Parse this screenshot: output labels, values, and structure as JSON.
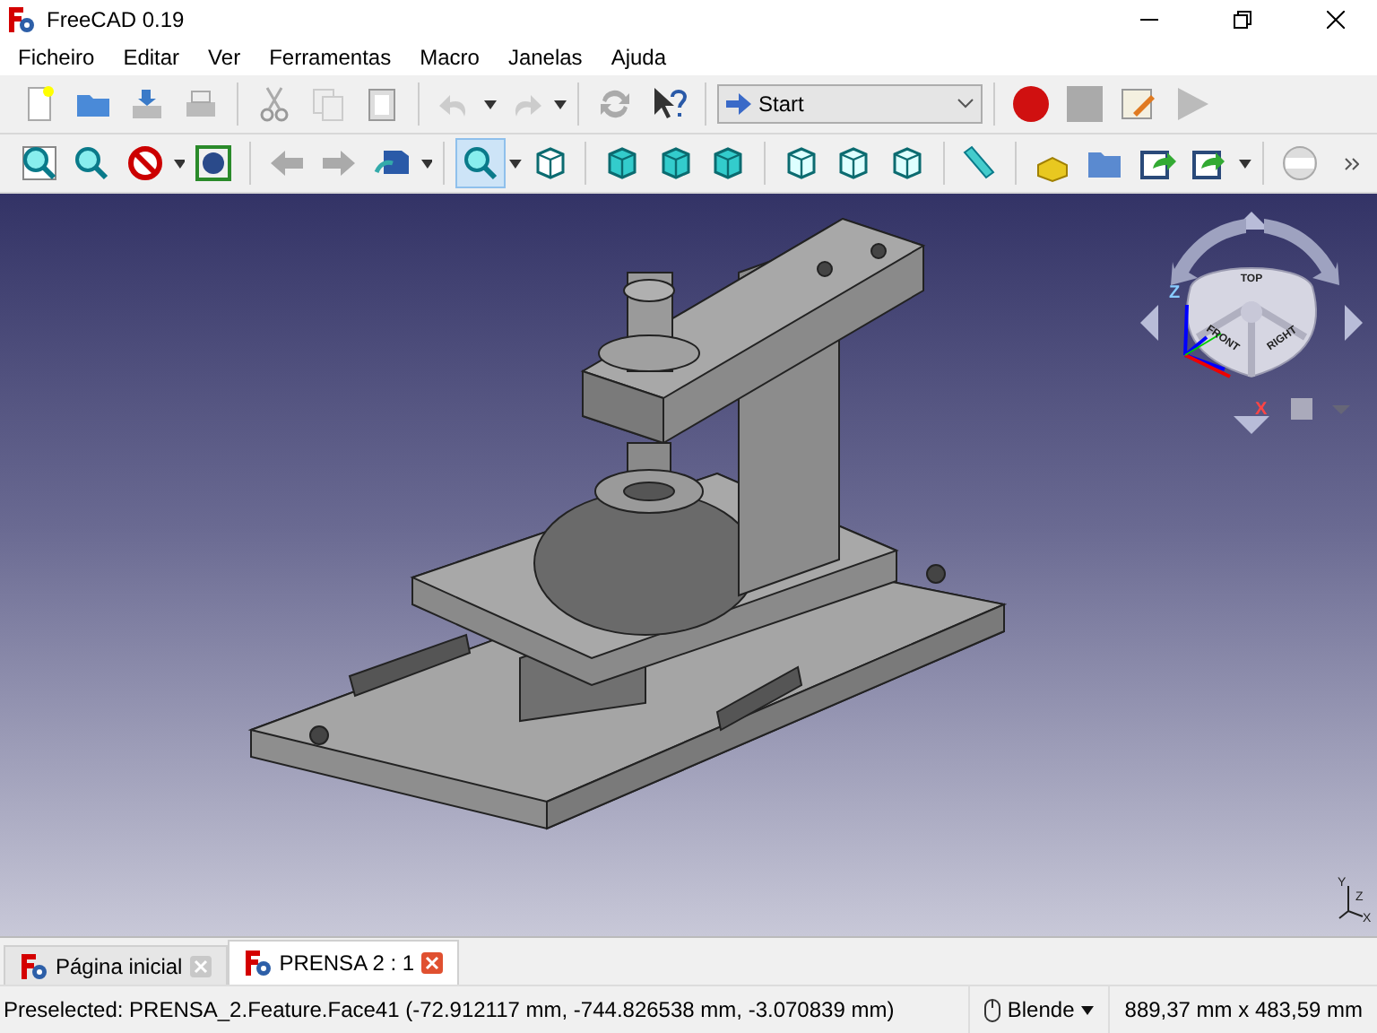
{
  "window": {
    "title": "FreeCAD 0.19"
  },
  "menu": [
    "Ficheiro",
    "Editar",
    "Ver",
    "Ferramentas",
    "Macro",
    "Janelas",
    "Ajuda"
  ],
  "workbench_selector": {
    "value": "Start"
  },
  "view_tools": [
    {
      "kind": "fit-all",
      "selected": false
    },
    {
      "kind": "fit-selection",
      "selected": false
    },
    {
      "kind": "draw-style",
      "selected": false
    },
    {
      "kind": "bounding-box",
      "selected": false
    },
    {
      "kind": "back",
      "selected": false
    },
    {
      "kind": "forward",
      "selected": false
    },
    {
      "kind": "sync",
      "selected": false
    },
    {
      "kind": "zoom",
      "selected": true
    },
    {
      "kind": "iso",
      "selected": false
    },
    {
      "kind": "front",
      "selected": false
    },
    {
      "kind": "top",
      "selected": false
    },
    {
      "kind": "right",
      "selected": false
    },
    {
      "kind": "rear",
      "selected": false
    },
    {
      "kind": "bottom",
      "selected": false
    },
    {
      "kind": "left",
      "selected": false
    },
    {
      "kind": "measure",
      "selected": false
    }
  ],
  "navigation_cube": {
    "faces": [
      "TOP",
      "FRONT",
      "RIGHT"
    ],
    "axes": [
      "Z",
      "X"
    ]
  },
  "axis_cross": [
    "Y",
    "Z",
    "X"
  ],
  "document_tabs": [
    {
      "label": "Página inicial",
      "selected": false
    },
    {
      "label": "PRENSA 2 : 1",
      "selected": true
    }
  ],
  "status_bar": {
    "message": "Preselected: PRENSA_2.Feature.Face41 (-72.912117 mm, -744.826538 mm, -3.070839 mm)",
    "navigation_style": "Blende",
    "dimensions": "889,37 mm x 483,59 mm"
  }
}
